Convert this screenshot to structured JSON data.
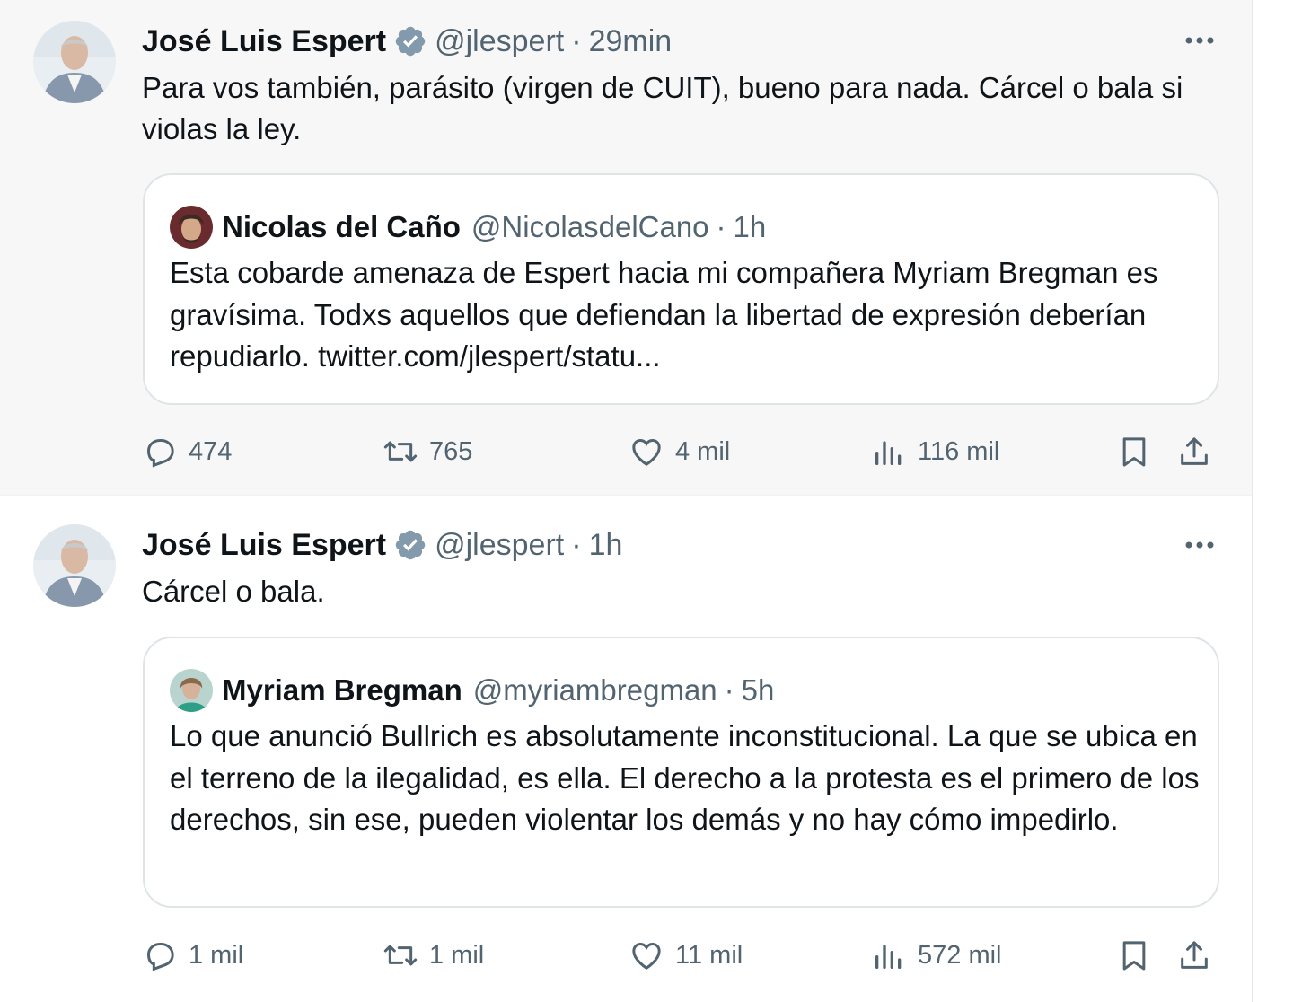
{
  "tweets": [
    {
      "author": "José Luis Espert",
      "handle": "@jlespert",
      "sep": "·",
      "time": "29min",
      "text": "Para vos también, parásito (virgen de CUIT), bueno para nada. Cárcel o bala si violas la ley.",
      "quote": {
        "author": "Nicolas del Caño",
        "handle": "@NicolasdelCano",
        "sep": "·",
        "time": "1h",
        "text": "Esta cobarde amenaza de Espert hacia mi compañera Myriam Bregman es gravísima. Todxs aquellos que defiendan la libertad de expresión deberían repudiarlo. twitter.com/jlespert/statu..."
      },
      "stats": {
        "replies": "474",
        "retweets": "765",
        "likes": "4 mil",
        "views": "116 mil"
      }
    },
    {
      "author": "José Luis Espert",
      "handle": "@jlespert",
      "sep": "·",
      "time": "1h",
      "text": "Cárcel o bala.",
      "quote": {
        "author": "Myriam Bregman",
        "handle": "@myriambregman",
        "sep": "·",
        "time": "5h",
        "text": "Lo que anunció Bullrich es absolutamente inconstitucional. La que se ubica en el terreno de la ilegalidad, es ella. El derecho a la protesta es el primero de los derechos,  sin ese, pueden violentar los demás y no hay cómo impedirlo."
      },
      "stats": {
        "replies": "1 mil",
        "retweets": "1 mil",
        "likes": "11 mil",
        "views": "572 mil"
      }
    }
  ],
  "colors": {
    "verified": "#829aab",
    "secondary_text": "#536471",
    "border": "#dfe4e7"
  },
  "icons": [
    "verified-badge-icon",
    "more-icon",
    "reply-icon",
    "retweet-icon",
    "like-icon",
    "views-icon",
    "bookmark-icon",
    "share-icon"
  ]
}
